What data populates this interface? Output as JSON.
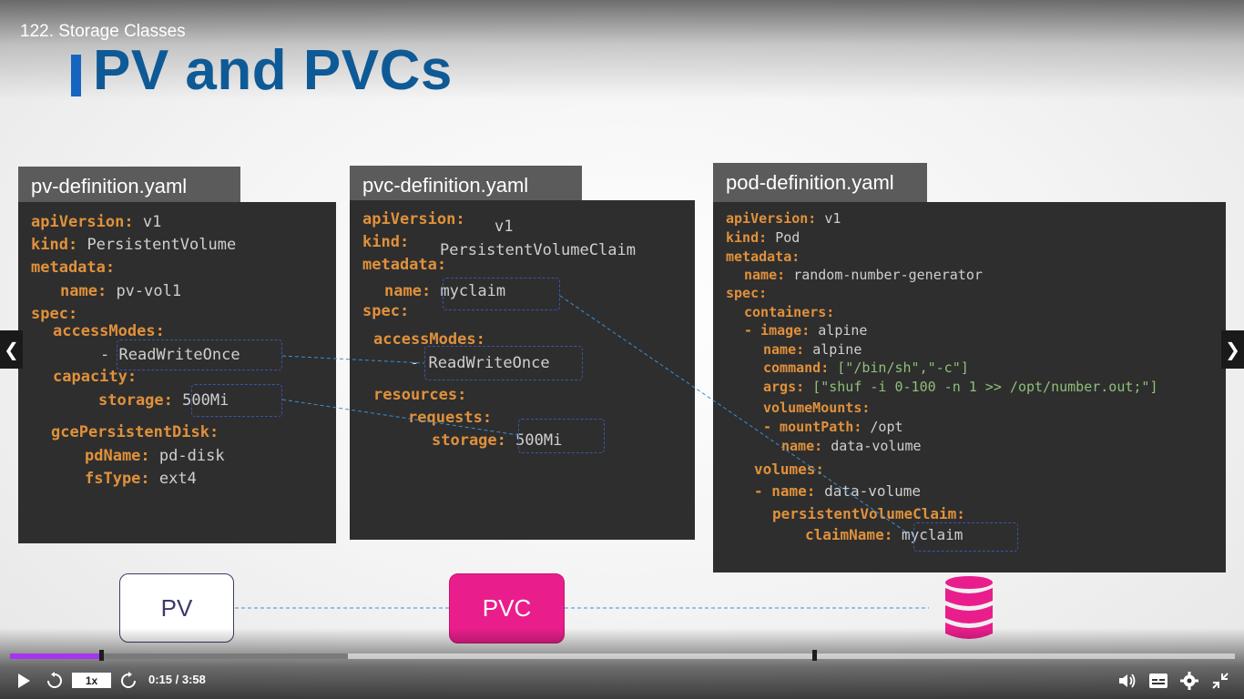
{
  "lecture": {
    "title": "122. Storage Classes"
  },
  "slide": {
    "title": "PV and PVCs",
    "files": {
      "pv": {
        "tab": "pv-definition.yaml"
      },
      "pvc": {
        "tab": "pvc-definition.yaml"
      },
      "pod": {
        "tab": "pod-definition.yaml"
      }
    },
    "pv_code": [
      {
        "key": "apiVersion:",
        "val": "v1"
      },
      {
        "key": "kind:",
        "val": "PersistentVolume"
      },
      {
        "key": "metadata:",
        "val": ""
      },
      {
        "key": "name:",
        "val": "pv-vol1"
      },
      {
        "key": "spec:",
        "val": ""
      },
      {
        "key": "accessModes:",
        "val": ""
      },
      {
        "key": "-",
        "val": "ReadWriteOnce"
      },
      {
        "key": "capacity:",
        "val": ""
      },
      {
        "key": "storage:",
        "val": "500Mi"
      },
      {
        "key": "gcePersistentDisk:",
        "val": ""
      },
      {
        "key": "pdName:",
        "val": "pd-disk"
      },
      {
        "key": "fsType:",
        "val": "ext4"
      }
    ],
    "pvc_code": [
      {
        "key": "apiVersion:",
        "val": "v1"
      },
      {
        "key": "kind:",
        "val": "PersistentVolumeClaim"
      },
      {
        "key": "metadata:",
        "val": ""
      },
      {
        "key": "name:",
        "val": "myclaim"
      },
      {
        "key": "spec:",
        "val": ""
      },
      {
        "key": "accessModes:",
        "val": ""
      },
      {
        "key": "-",
        "val": "ReadWriteOnce"
      },
      {
        "key": "resources:",
        "val": ""
      },
      {
        "key": "requests:",
        "val": ""
      },
      {
        "key": "storage:",
        "val": "500Mi"
      }
    ],
    "pod_code": [
      {
        "key": "apiVersion:",
        "val": "v1"
      },
      {
        "key": "kind:",
        "val": "Pod"
      },
      {
        "key": "metadata:",
        "val": ""
      },
      {
        "key": "name:",
        "val": "random-number-generator"
      },
      {
        "key": "spec:",
        "val": ""
      },
      {
        "key": "containers:",
        "val": ""
      },
      {
        "key": "- image:",
        "val": "alpine"
      },
      {
        "key": "name:",
        "val": "alpine"
      },
      {
        "key": "command:",
        "val": "[\"/bin/sh\",\"-c\"]"
      },
      {
        "key": "args:",
        "val": "[\"shuf -i 0-100 -n 1 >> /opt/number.out;\"]"
      },
      {
        "key": "volumeMounts:",
        "val": ""
      },
      {
        "key": "- mountPath:",
        "val": "/opt"
      },
      {
        "key": "name:",
        "val": "data-volume"
      },
      {
        "key": "volumes:",
        "val": ""
      },
      {
        "key": "- name:",
        "val": "data-volume"
      },
      {
        "key": "persistentVolumeClaim:",
        "val": ""
      },
      {
        "key": "claimName:",
        "val": "myclaim"
      }
    ],
    "diagram": {
      "pv_label": "PV",
      "pvc_label": "PVC",
      "db_icon": "database-icon"
    },
    "colors": {
      "title": "#0e5a96",
      "pvc": "#e91e8c",
      "key": "#e0913b"
    }
  },
  "player": {
    "speed": "1x",
    "time": "0:15 / 3:58",
    "progress_fraction": 0.063,
    "icons": {
      "play": "play-icon",
      "rewind": "rewind-5-icon",
      "forward": "forward-5-icon",
      "volume": "volume-icon",
      "captions": "captions-icon",
      "settings": "gear-icon",
      "fullscreen": "exit-fullscreen-icon",
      "prev": "chevron-left-icon",
      "next": "chevron-right-icon"
    }
  }
}
